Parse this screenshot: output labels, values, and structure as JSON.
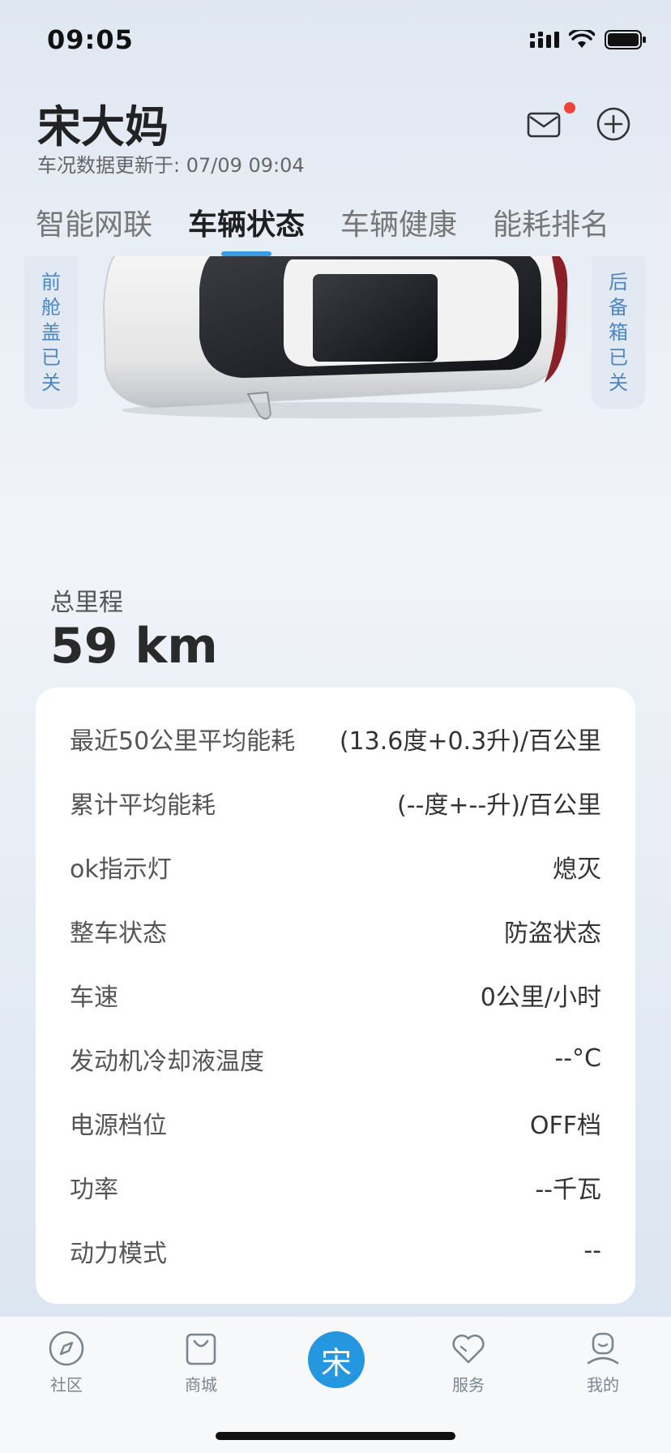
{
  "status_bar": {
    "time": "09:05"
  },
  "header": {
    "title": "宋大妈",
    "subtitle": "车况数据更新于: 07/09 09:04"
  },
  "tabs": [
    {
      "label": "智能网联"
    },
    {
      "label": "车辆状态"
    },
    {
      "label": "车辆健康"
    },
    {
      "label": "能耗排名"
    }
  ],
  "car": {
    "front_tag": "前舱盖已关",
    "rear_tag": "后备箱已关"
  },
  "mileage": {
    "label": "总里程",
    "value": "59 km"
  },
  "stats": [
    {
      "label": "最近50公里平均能耗",
      "value": "(13.6度+0.3升)/百公里"
    },
    {
      "label": "累计平均能耗",
      "value": "(--度+--升)/百公里"
    },
    {
      "label": "ok指示灯",
      "value": "熄灭"
    },
    {
      "label": "整车状态",
      "value": "防盗状态"
    },
    {
      "label": "车速",
      "value": "0公里/小时"
    },
    {
      "label": "发动机冷却液温度",
      "value": "--°C"
    },
    {
      "label": "电源档位",
      "value": "OFF档"
    },
    {
      "label": "功率",
      "value": "--千瓦"
    },
    {
      "label": "动力模式",
      "value": "--"
    }
  ],
  "bottom_nav": {
    "items": [
      {
        "label": "社区",
        "icon": "compass-icon"
      },
      {
        "label": "商城",
        "icon": "shopping-bag-icon"
      },
      {
        "label": "",
        "icon": "song-brand-icon",
        "glyph": "宋"
      },
      {
        "label": "服务",
        "icon": "heart-icon"
      },
      {
        "label": "我的",
        "icon": "profile-icon"
      }
    ]
  },
  "colors": {
    "accent": "#2596e0",
    "tab_indicator": "#3a9be2",
    "notification_dot": "#f0443a",
    "tag_text": "#4a86c5"
  }
}
